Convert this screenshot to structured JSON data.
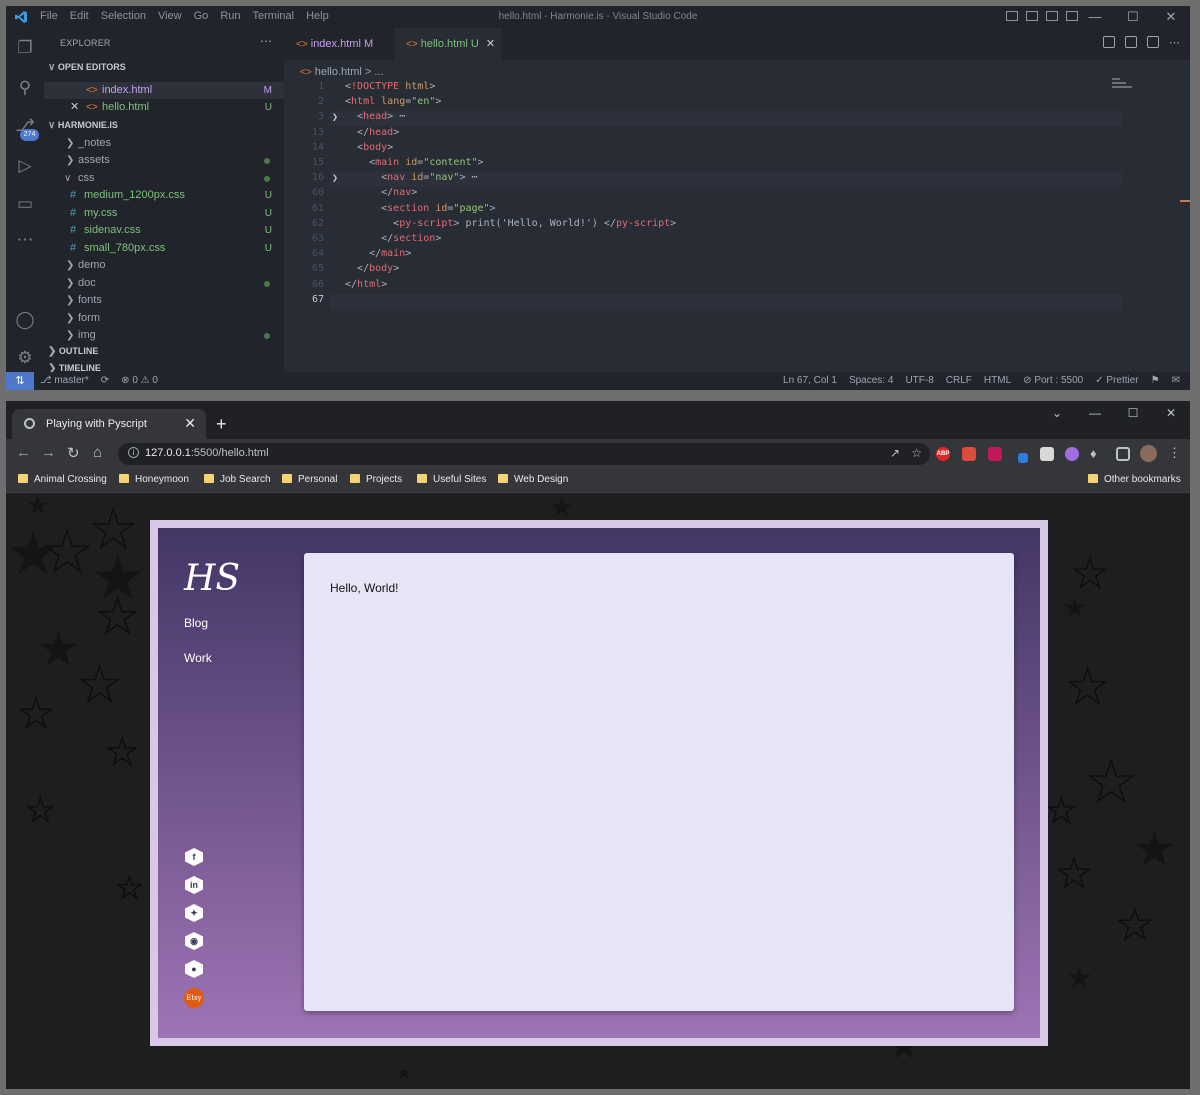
{
  "vscode": {
    "menu": [
      "File",
      "Edit",
      "Selection",
      "View",
      "Go",
      "Run",
      "Terminal",
      "Help"
    ],
    "window_title": "hello.html - Harmonie.is - Visual Studio Code",
    "source_control_badge": "274",
    "explorer": {
      "header": "EXPLORER",
      "open_editors_label": "OPEN EDITORS",
      "open_editors": [
        {
          "name": "index.html",
          "status": "M"
        },
        {
          "name": "hello.html",
          "status": "U"
        }
      ],
      "project_label": "HARMONIE.IS",
      "tree": [
        {
          "name": "_notes",
          "type": "folder"
        },
        {
          "name": "assets",
          "type": "folder"
        },
        {
          "name": "css",
          "type": "folder-open"
        },
        {
          "name": "medium_1200px.css",
          "type": "file",
          "status": "U"
        },
        {
          "name": "my.css",
          "type": "file",
          "status": "U"
        },
        {
          "name": "sidenav.css",
          "type": "file",
          "status": "U"
        },
        {
          "name": "small_780px.css",
          "type": "file",
          "status": "U"
        },
        {
          "name": "demo",
          "type": "folder"
        },
        {
          "name": "doc",
          "type": "folder"
        },
        {
          "name": "fonts",
          "type": "folder"
        },
        {
          "name": "form",
          "type": "folder"
        },
        {
          "name": "img",
          "type": "folder"
        }
      ],
      "outline_label": "OUTLINE",
      "timeline_label": "TIMELINE"
    },
    "tabs": [
      {
        "name": "index.html",
        "status": "M"
      },
      {
        "name": "hello.html",
        "status": "U"
      }
    ],
    "breadcrumb": "hello.html > ...",
    "line_numbers": [
      "1",
      "2",
      "3",
      "13",
      "14",
      "15",
      "16",
      "60",
      "61",
      "62",
      "63",
      "64",
      "65",
      "66",
      "67"
    ],
    "status": {
      "branch": "master*",
      "problems": "0 ⚠ 0",
      "position": "Ln 67, Col 1",
      "spaces": "Spaces: 4",
      "encoding": "UTF-8",
      "eol": "CRLF",
      "language": "HTML",
      "port": "Port : 5500",
      "formatter": "Prettier"
    }
  },
  "browser": {
    "tab_title": "Playing with Pyscript",
    "url_host": "127.0.0.1",
    "url_path": ":5500/hello.html",
    "bookmarks": [
      "Animal Crossing",
      "Honeymoon",
      "Job Search",
      "Personal",
      "Projects",
      "Useful Sites",
      "Web Design"
    ],
    "other_bookmarks": "Other bookmarks",
    "ext_abp": "ABP",
    "site": {
      "logo": "HS",
      "nav": [
        "Blog",
        "Work"
      ],
      "social_icons": [
        "facebook-icon",
        "linkedin-icon",
        "twitter-icon",
        "instagram-icon",
        "github-icon"
      ],
      "etsy_label": "Etsy",
      "content": "Hello, World!",
      "colors": {
        "gradient_top": "#433666",
        "gradient_bottom": "#9e74b4",
        "card": "#e6e4f7",
        "frame": "#d8c8e6"
      }
    }
  }
}
